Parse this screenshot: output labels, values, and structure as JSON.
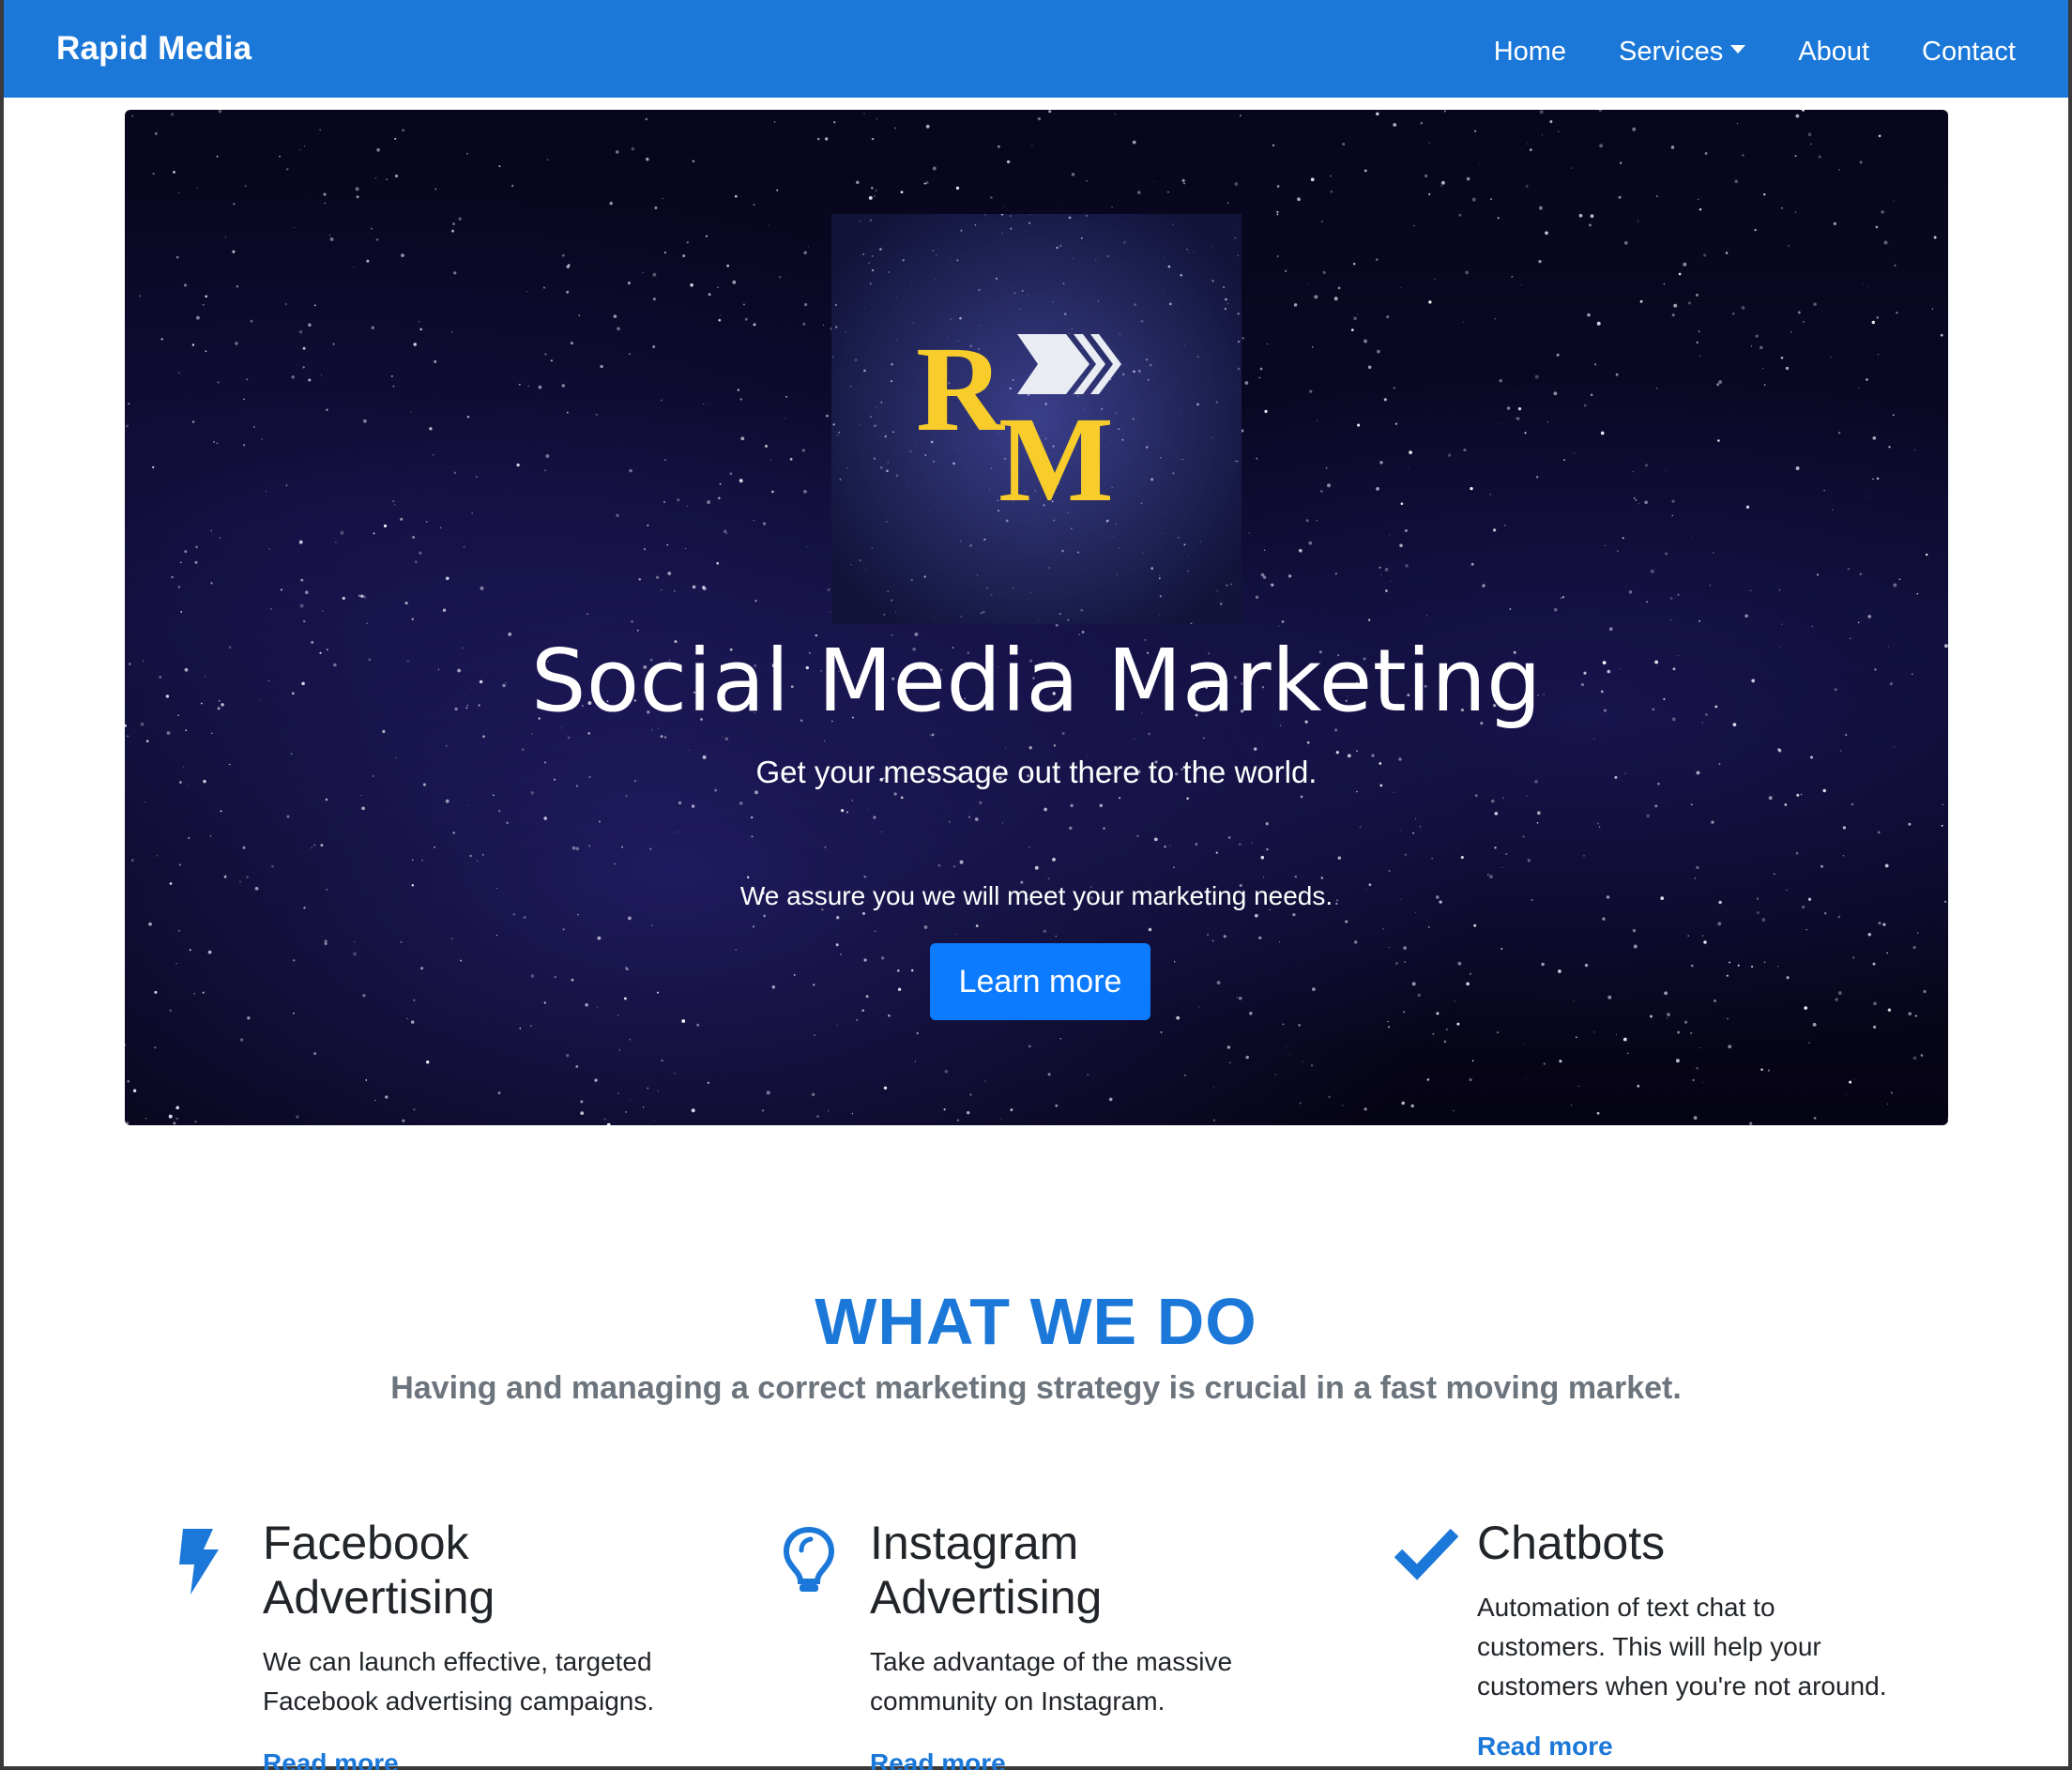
{
  "navbar": {
    "brand": "Rapid Media",
    "links": [
      "Home",
      "Services",
      "About",
      "Contact"
    ]
  },
  "hero": {
    "title": "Social Media Marketing",
    "subtitle": "Get your message out there to the world.",
    "text": "We assure you we will meet your marketing needs.",
    "button_label": "Learn more",
    "logo_letters": "RM"
  },
  "section": {
    "title": "WHAT WE DO",
    "subtitle": "Having and managing a correct marketing strategy is crucial in a fast moving market."
  },
  "features": [
    {
      "icon": "bolt-icon",
      "title_line1": "Facebook",
      "title_line2": "Advertising",
      "desc_line1": "We can launch effective, targeted",
      "desc_line2": "Facebook advertising campaigns.",
      "link": "Read more"
    },
    {
      "icon": "lightbulb-icon",
      "title_line1": "Instagram",
      "title_line2": "Advertising",
      "desc_line1": "Take advantage of the massive",
      "desc_line2": "community on Instagram.",
      "link": "Read more"
    },
    {
      "icon": "checkmark-icon",
      "title_line1": "Chatbots",
      "desc_line1": "Automation of text chat to",
      "desc_line2": "customers. This will help your",
      "desc_line3": "customers when you're not around.",
      "link": "Read more"
    }
  ],
  "colors": {
    "primary": "#1b78d9",
    "button": "#0d7bff",
    "logo_gold": "#f7cc2b",
    "muted": "#6c757d"
  }
}
